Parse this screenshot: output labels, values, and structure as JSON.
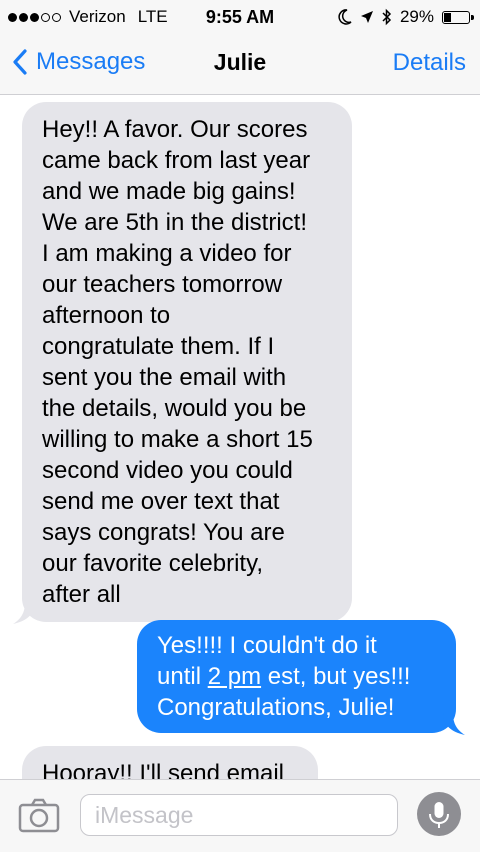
{
  "status_bar": {
    "carrier": "Verizon",
    "network": "LTE",
    "time": "9:55 AM",
    "battery": "29%",
    "battery_level": 0.29
  },
  "nav": {
    "back_label": "Messages",
    "title": "Julie",
    "details_label": "Details"
  },
  "messages": [
    {
      "direction": "incoming",
      "text": "Hey!! A favor. Our scores\ncame back from last year\nand we made big gains!\nWe are 5th in the district!\nI am making a video for\nour teachers tomorrow\nafternoon to\ncongratulate them. If I\nsent you the email with\nthe details, would you be\nwilling to make a short 15\nsecond video you could\nsend me over text that\nsays congrats! You are\nour favorite celebrity,\nafter all"
    },
    {
      "direction": "outgoing",
      "line1": "Yes!!!! I couldn't do it",
      "line2_before": "until ",
      "line2_link": "2 pm",
      "line2_after": " est, but yes!!!",
      "line3": "Congratulations, Julie!"
    },
    {
      "direction": "incoming",
      "text": "Hooray!! I'll send email"
    }
  ],
  "input": {
    "placeholder": "iMessage"
  },
  "colors": {
    "accent": "#1a7cf5",
    "outgoing_bubble": "#1b84fc",
    "incoming_bubble": "#e5e5ea"
  }
}
